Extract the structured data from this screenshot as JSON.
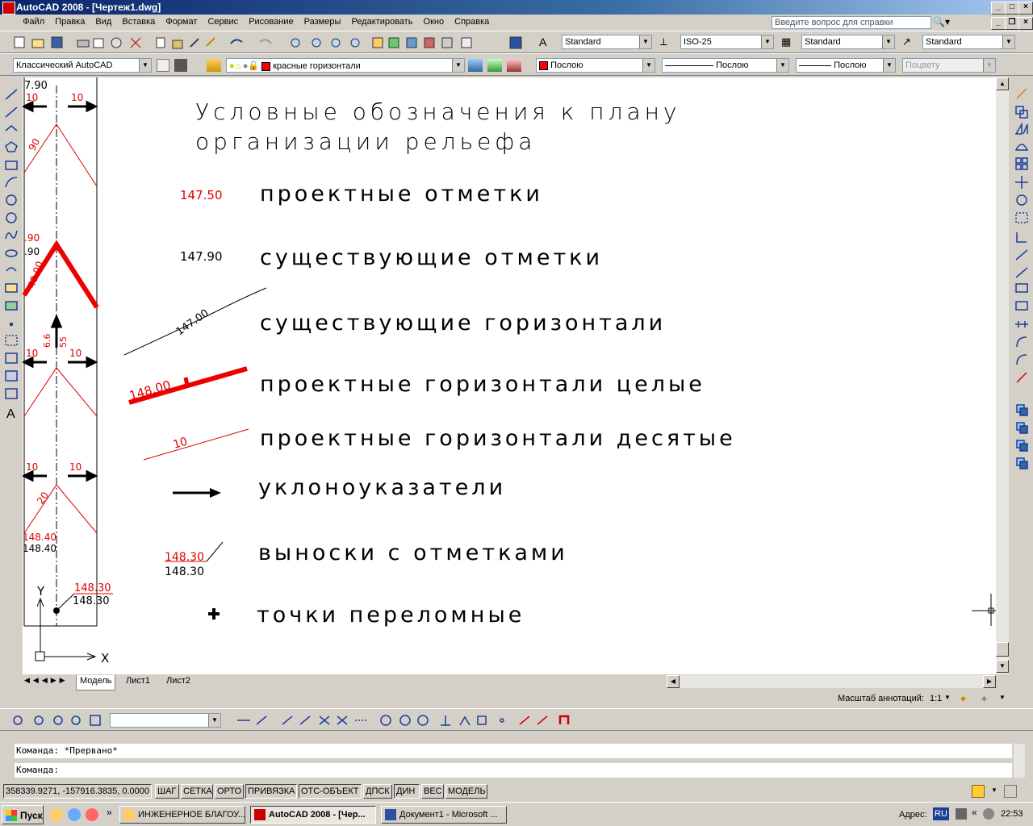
{
  "window": {
    "title": "AutoCAD 2008 - [Чертеж1.dwg]"
  },
  "menu": [
    "Файл",
    "Правка",
    "Вид",
    "Вставка",
    "Формат",
    "Сервис",
    "Рисование",
    "Размеры",
    "Редактировать",
    "Окно",
    "Справка"
  ],
  "help": {
    "placeholder": "Введите вопрос для справки"
  },
  "styles": {
    "text_style": "Standard",
    "dim_style": "ISO-25",
    "table_style": "Standard",
    "mleader_style": "Standard"
  },
  "workspace": "Классический AutoCAD",
  "layer": {
    "current": "красные горизонтали",
    "color": "#ff0000"
  },
  "properties": {
    "color": "Послою",
    "linetype": "Послою",
    "lineweight": "Послою",
    "plotstyle": "Поцвету"
  },
  "legend": {
    "title_line1": "Условные обозначения к плану",
    "title_line2": "организации рельефа",
    "items": [
      {
        "label": "проектные отметки",
        "sample": "147.50"
      },
      {
        "label": "существующие отметки",
        "sample": "147.90"
      },
      {
        "label": "существующие горизонтали",
        "sample": "147.00"
      },
      {
        "label": "проектные горизонтали целые",
        "sample": "148.00"
      },
      {
        "label": "проектные горизонтали десятые",
        "sample": "10"
      },
      {
        "label": "уклоноуказатели"
      },
      {
        "label": "выноски с отметками",
        "sample_red": "148.30",
        "sample_black": "148.30"
      },
      {
        "label": "точки переломные"
      }
    ]
  },
  "plan": {
    "top_label": "7.90",
    "slope_a": "10",
    "slope_b": "10",
    "mark1": ".90",
    "mark2": ".90",
    "mark_red": "148.40",
    "mark_black": "148.40",
    "leader_red": "148.30",
    "leader_black": "148.30",
    "contour": "40.00",
    "contour_small": "90",
    "slope_pct": "20",
    "vert1": "6.6",
    "vert2": "55",
    "axis_x": "X",
    "axis_y": "Y"
  },
  "tabs": [
    "Модель",
    "Лист1",
    "Лист2"
  ],
  "annotation_scale": {
    "label": "Масштаб аннотаций:",
    "value": "1:1"
  },
  "command": {
    "history": "Команда: *Прервано*",
    "prompt": "Команда:"
  },
  "status": {
    "coords": "358339.9271, -157916.3835, 0.0000",
    "toggles": [
      "ШАГ",
      "СЕТКА",
      "ОРТО",
      "ПРИВЯЗКА",
      "ОТС-ОБЪЕКТ",
      "ДПСК",
      "ДИН",
      "ВЕС",
      "МОДЕЛЬ"
    ]
  },
  "taskbar": {
    "start": "Пуск",
    "tasks": [
      "ИНЖЕНЕРНОЕ БЛАГОУ...",
      "AutoCAD 2008 - [Чер...",
      "Документ1 - Microsoft ..."
    ],
    "address_label": "Адрес:",
    "lang": "RU",
    "time": "22:53"
  }
}
